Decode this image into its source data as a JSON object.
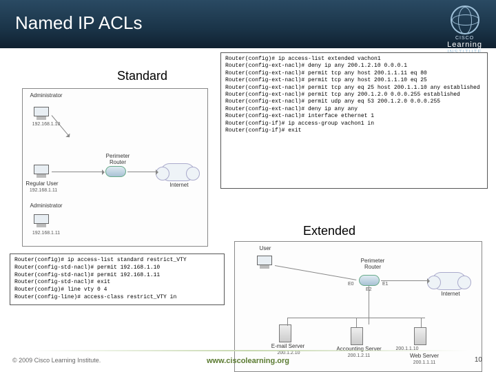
{
  "header": {
    "title": "Named IP ACLs",
    "logo": {
      "cisco": "CISCO",
      "learning": "Learning",
      "institute": "INSTITUTE"
    }
  },
  "labels": {
    "standard": "Standard",
    "extended": "Extended"
  },
  "code": {
    "extended": "Router(config)# ip access-list extended vachon1\nRouter(config-ext-nacl)# deny ip any 200.1.2.10 0.0.0.1\nRouter(config-ext-nacl)# permit tcp any host 200.1.1.11 eq 80\nRouter(config-ext-nacl)# permit tcp any host 200.1.1.10 eq 25\nRouter(config-ext-nacl)# permit tcp any eq 25 host 200.1.1.10 any established\nRouter(config-ext-nacl)# permit tcp any 200.1.2.0 0.0.0.255 established\nRouter(config-ext-nacl)# permit udp any eq 53 200.1.2.0 0.0.0.255\nRouter(config-ext-nacl)# deny ip any any\nRouter(config-ext-nacl)# interface ethernet 1\nRouter(config-if)# ip access-group vachon1 in\nRouter(config-if)# exit",
    "standard": "Router(config)# ip access-list standard restrict_VTY\nRouter(config-std-nacl)# permit 192.168.1.10\nRouter(config-std-nacl)# permit 192.168.1.11\nRouter(config-std-nacl)# exit\nRouter(config)# line vty 0 4\nRouter(config-line)# access-class restrict_VTY in"
  },
  "diagram1": {
    "admin": "Administrator",
    "admin_ip": "192.168.1.10",
    "reguser": "Regular User",
    "reguser_ip": "192.168.1.11",
    "admin2": "Administrator",
    "admin2_ip": "192.168.1.11",
    "perimeter": "Perimeter\nRouter",
    "internet": "Internet"
  },
  "diagram2": {
    "user": "User",
    "perimeter": "Perimeter\nRouter",
    "internet": "Internet",
    "e0": "E0",
    "e1": "E1",
    "e2": "E2",
    "email": "E-mail Server",
    "email_ip": "200.1.2.10",
    "acct": "Accounting Server",
    "acct_ip": "200.1.2.11",
    "web": "Web Server",
    "web_ip": "200.1.1.11",
    "dmz": "200.1.1.10"
  },
  "footer": {
    "copyright": "© 2009 Cisco Learning Institute.",
    "url": "www.ciscolearning.org",
    "page": "10"
  }
}
